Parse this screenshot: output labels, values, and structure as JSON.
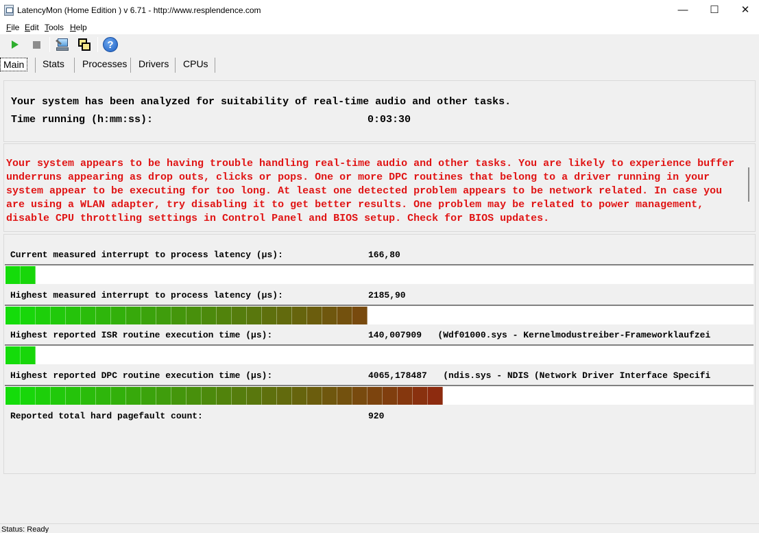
{
  "window": {
    "title": "LatencyMon  (Home Edition )  v 6.71 - http://www.resplendence.com",
    "minimize_glyph": "—",
    "maximize_glyph": "☐",
    "close_glyph": "✕"
  },
  "menu": {
    "items": [
      {
        "accel": "F",
        "rest": "ile"
      },
      {
        "accel": "E",
        "rest": "dit"
      },
      {
        "accel": "T",
        "rest": "ools"
      },
      {
        "accel": "H",
        "rest": "elp"
      }
    ]
  },
  "toolbar": {
    "icons": [
      "play-icon",
      "stop-icon",
      "scan-icon",
      "windows-icon",
      "help-icon"
    ],
    "help_glyph": "?"
  },
  "tabs": [
    {
      "label": "Main",
      "active": true
    },
    {
      "label": "Stats",
      "active": false
    },
    {
      "label": "Processes",
      "active": false
    },
    {
      "label": "Drivers",
      "active": false
    },
    {
      "label": "CPUs",
      "active": false
    }
  ],
  "summary": {
    "headline": "Your system has been analyzed for suitability of real-time audio and other tasks.",
    "time_label": "Time running (h:mm:ss):",
    "time_value": "0:03:30"
  },
  "warning": {
    "text": "Your system appears to be having trouble handling real-time audio and other tasks. You are likely to experience buffer underruns appearing as drop outs, clicks or pops. One or more DPC routines that belong to a driver running in your system appear to be executing for too long. At least one detected problem appears to be network related. In case you are using a WLAN adapter, try disabling it to get better results. One problem may be related to power management, disable CPU throttling settings in Control Panel and BIOS setup. Check for BIOS updates.",
    "color": "#e01414"
  },
  "metrics": [
    {
      "label": "Current measured interrupt to process latency (µs):",
      "value": "166,80",
      "extra": "",
      "segments": 2
    },
    {
      "label": "Highest measured interrupt to process latency (µs):",
      "value": "2185,90",
      "extra": "",
      "segments": 24
    },
    {
      "label": "Highest reported ISR routine execution time (µs):",
      "value": "140,007909",
      "extra": "(Wdf01000.sys - Kernelmodustreiber-Frameworklaufzei",
      "segments": 2
    },
    {
      "label": "Highest reported DPC routine execution time (µs):",
      "value": "4065,178487",
      "extra": "(ndis.sys - NDIS (Network Driver Interface Specifi",
      "segments": 29
    }
  ],
  "pagefault": {
    "label": "Reported total hard pagefault count:",
    "value": "920"
  },
  "status": {
    "text": "Status: Ready"
  }
}
